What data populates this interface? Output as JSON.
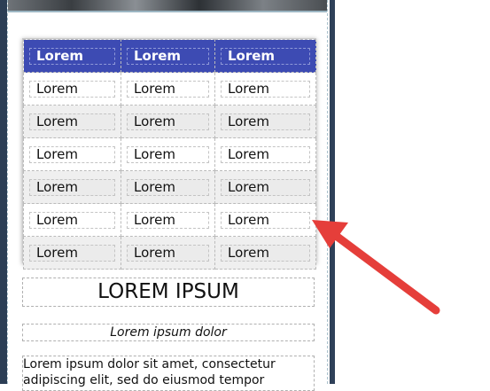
{
  "table": {
    "header": [
      "Lorem",
      "Lorem",
      "Lorem"
    ],
    "rows": [
      [
        "Lorem",
        "Lorem",
        "Lorem"
      ],
      [
        "Lorem",
        "Lorem",
        "Lorem"
      ],
      [
        "Lorem",
        "Lorem",
        "Lorem"
      ],
      [
        "Lorem",
        "Lorem",
        "Lorem"
      ],
      [
        "Lorem",
        "Lorem",
        "Lorem"
      ],
      [
        "Lorem",
        "Lorem",
        "Lorem"
      ]
    ]
  },
  "heading": "LOREM IPSUM",
  "subheading": "Lorem ipsum dolor",
  "body_text": "Lorem ipsum dolor sit amet, consectetur adipiscing elit, sed do eiusmod tempor",
  "colors": {
    "header_bg": "#3d4bb3",
    "arrow": "#e53e3a",
    "frame": "#2c3e55"
  }
}
